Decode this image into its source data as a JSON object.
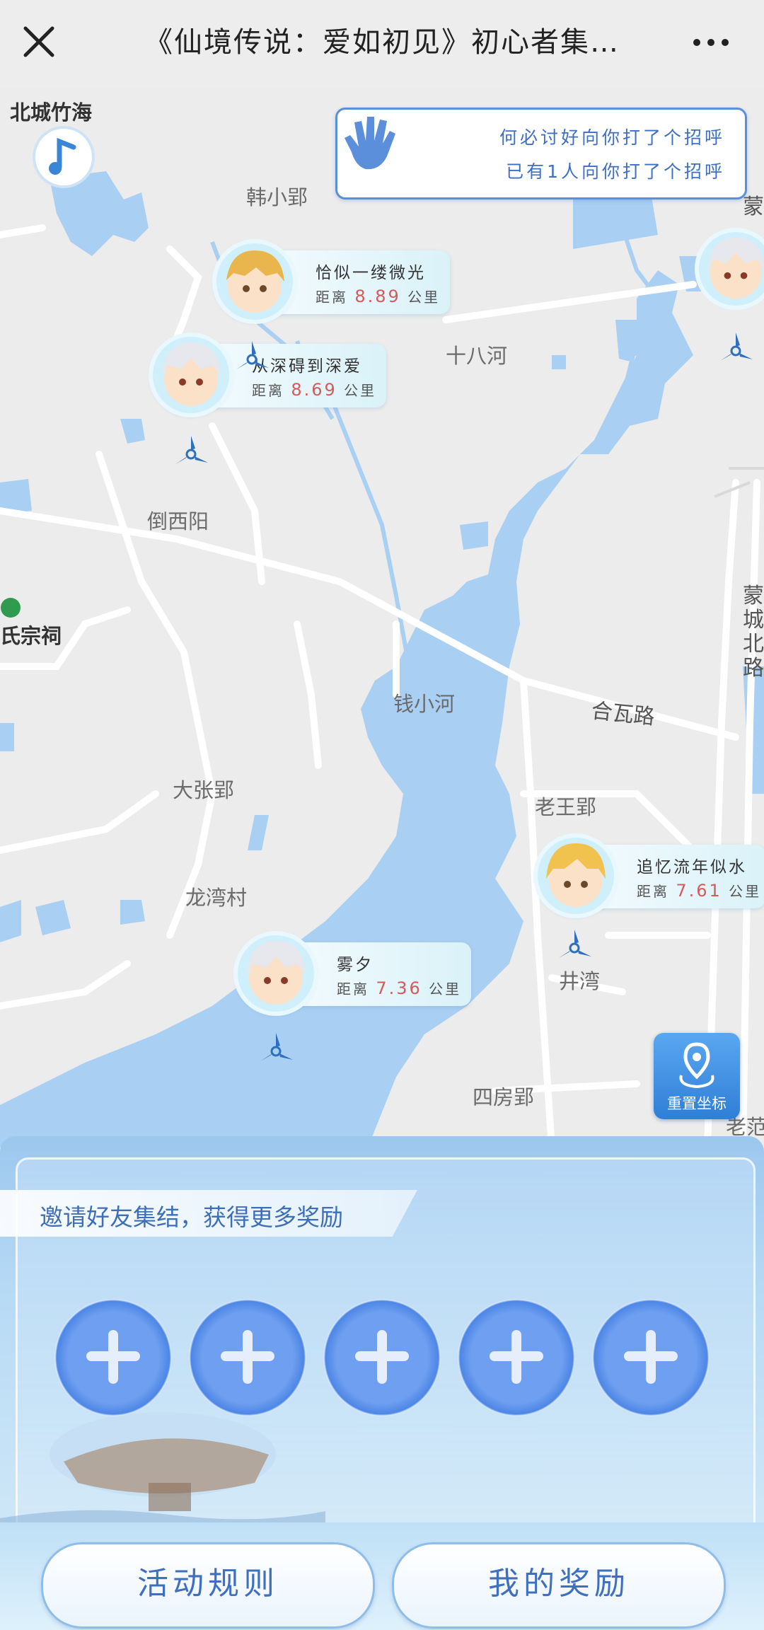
{
  "window": {
    "title": "《仙境传说：爱如初见》初心者集…",
    "close_icon": "close-icon",
    "more_icon": "more-dots-icon"
  },
  "map": {
    "places": [
      {
        "name": "北城竹海"
      },
      {
        "name": "韩小郢"
      },
      {
        "name": "十八河"
      },
      {
        "name": "倒西阳"
      },
      {
        "name": "氏宗祠"
      },
      {
        "name": "钱小河"
      },
      {
        "name": "合瓦路"
      },
      {
        "name": "大张郢"
      },
      {
        "name": "老王郢"
      },
      {
        "name": "龙湾村"
      },
      {
        "name": "井湾"
      },
      {
        "name": "四房郢"
      },
      {
        "name": "老范"
      }
    ],
    "vertical_labels": [
      "蒙城北路",
      "蒙"
    ],
    "reset_button_label": "重置坐标"
  },
  "greeting": {
    "line1": "何必讨好向你打了个招呼",
    "line2": "已有1人向你打了个招呼",
    "icon": "wave-hand-icon"
  },
  "players": [
    {
      "name": "恰似一缕微光",
      "dist_prefix": "距离",
      "distance": "8.89",
      "unit": "公里"
    },
    {
      "name": "从深碍到深爱",
      "dist_prefix": "距离",
      "distance": "8.69",
      "unit": "公里"
    },
    {
      "name": "追忆流年似水",
      "dist_prefix": "距离",
      "distance": "7.61",
      "unit": "公里"
    },
    {
      "name": "雾夕",
      "dist_prefix": "距离",
      "distance": "7.36",
      "unit": "公里"
    }
  ],
  "invite": {
    "banner": "邀请好友集结，获得更多奖励",
    "slot_count": 5
  },
  "footer": {
    "rules_button": "活动规则",
    "rewards_button": "我的奖励"
  },
  "colors": {
    "accent_blue": "#3f6fbf",
    "distance_red": "#d55a5a",
    "water": "#a9cff2"
  }
}
